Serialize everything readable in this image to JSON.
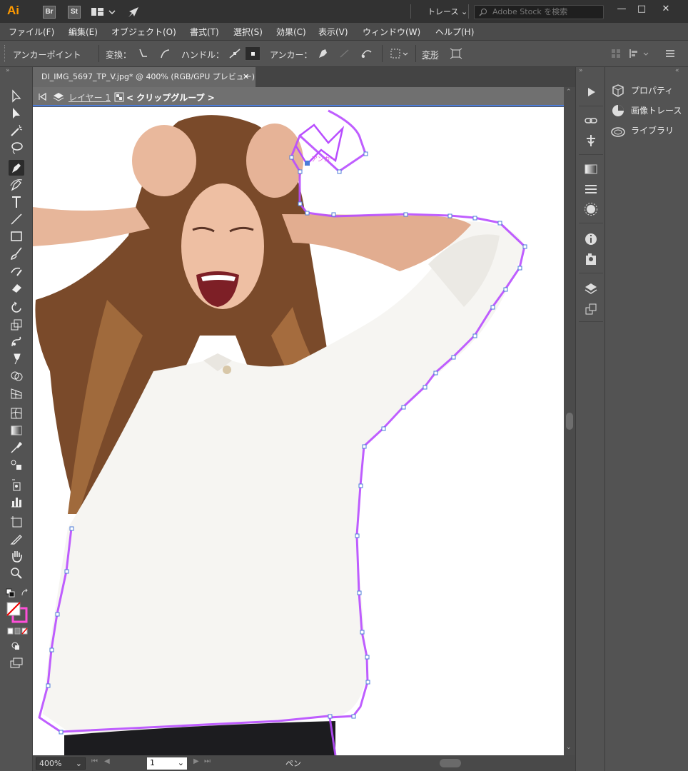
{
  "app": {
    "logo": "Ai",
    "badges": [
      "Br",
      "St"
    ],
    "workspace": "トレース",
    "search_placeholder": "Adobe Stock を検索"
  },
  "menu": [
    "ファイル(F)",
    "編集(E)",
    "オブジェクト(O)",
    "書式(T)",
    "選択(S)",
    "効果(C)",
    "表示(V)",
    "ウィンドウ(W)",
    "ヘルプ(H)"
  ],
  "control": {
    "title": "アンカーポイント",
    "convert_label": "変換：",
    "handle_label": "ハンドル：",
    "anchor_label": "アンカー：",
    "transform_label": "変形"
  },
  "document": {
    "tab_title": "DI_IMG_5697_TP_V.jpg* @ 400% (RGB/GPU プレビュー)",
    "layer": "レイヤー 1",
    "group": "< クリップグループ >",
    "anchor_hint": "アンカー",
    "zoom": "400%",
    "page": "1",
    "status": "ペン"
  },
  "panels": {
    "items": [
      "プロパティ",
      "画像トレース",
      "ライブラリ"
    ]
  },
  "colors": {
    "accent": "#4c7cd9",
    "path": "#b84dff",
    "logo": "#ff9a00"
  }
}
